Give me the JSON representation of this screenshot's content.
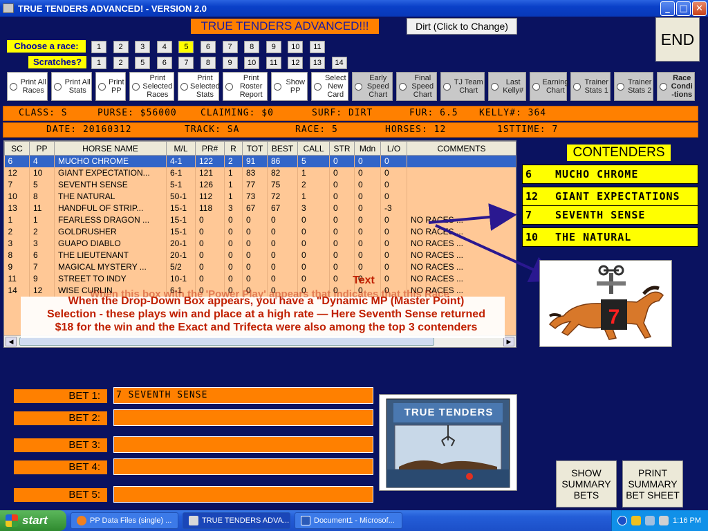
{
  "window": {
    "title": "TRUE TENDERS ADVANCED! - VERSION 2.0"
  },
  "header": {
    "title": "TRUE TENDERS ADVANCED!!!",
    "surface_button": "Dirt (Click to Change)",
    "end_button": "END"
  },
  "race_select": {
    "label": "Choose  a race:",
    "options": [
      "1",
      "2",
      "3",
      "4",
      "5",
      "6",
      "7",
      "8",
      "9",
      "10",
      "11"
    ],
    "selected": "5"
  },
  "scratches": {
    "label": "Scratches?",
    "options": [
      "1",
      "2",
      "5",
      "6",
      "7",
      "8",
      "9",
      "10",
      "11",
      "12",
      "13",
      "14"
    ]
  },
  "options": [
    {
      "label": "Print All Races"
    },
    {
      "label": "Print All Stats"
    },
    {
      "label": "Print PP"
    },
    {
      "label": "Print Selected Races"
    },
    {
      "label": "Print Selected Stats"
    },
    {
      "label": "Print Roster Report"
    },
    {
      "label": "Show PP"
    },
    {
      "label": "Select New Card"
    },
    {
      "label": "Early Speed Chart"
    },
    {
      "label": "Final Speed Chart"
    },
    {
      "label": "TJ Team Chart"
    },
    {
      "label": "Last Kelly#"
    },
    {
      "label": "Earning Chart"
    },
    {
      "label": "Trainer Stats 1"
    },
    {
      "label": "Trainer Stats 2"
    },
    {
      "label": "Race Condi -tions"
    }
  ],
  "race_info": {
    "class": "CLASS: S",
    "purse": "PURSE: $56000",
    "claiming": "CLAIMING: $0",
    "surface": "SURF: DIRT",
    "furlongs": "FUR: 6.5",
    "kelly": "KELLY#: 364",
    "date": "DATE: 20160312",
    "track": "TRACK: SA",
    "race": "RACE: 5",
    "horses": "HORSES: 12",
    "first_time": "1STTIME:  7"
  },
  "grid": {
    "columns": [
      "SC",
      "PP",
      "HORSE NAME",
      "M/L",
      "PR#",
      "R",
      "TOT",
      "BEST",
      "CALL",
      "STR",
      "Mdn",
      "L/O",
      "COMMENTS"
    ],
    "rows": [
      [
        "6",
        "4",
        "MUCHO CHROME",
        "4-1",
        "122",
        "2",
        "91",
        "86",
        "5",
        "0",
        "0",
        "0",
        ""
      ],
      [
        "12",
        "10",
        "GIANT EXPECTATION...",
        "6-1",
        "121",
        "1",
        "83",
        "82",
        "1",
        "0",
        "0",
        "0",
        ""
      ],
      [
        "7",
        "5",
        "SEVENTH SENSE",
        "5-1",
        "126",
        "1",
        "77",
        "75",
        "2",
        "0",
        "0",
        "0",
        ""
      ],
      [
        "10",
        "8",
        "THE NATURAL",
        "50-1",
        "112",
        "1",
        "73",
        "72",
        "1",
        "0",
        "0",
        "0",
        ""
      ],
      [
        "13",
        "11",
        "HANDFUL OF STRIP...",
        "15-1",
        "118",
        "3",
        "67",
        "67",
        "3",
        "0",
        "0",
        "-3",
        ""
      ],
      [
        "1",
        "1",
        "FEARLESS DRAGON ...",
        "15-1",
        "0",
        "0",
        "0",
        "0",
        "0",
        "0",
        "0",
        "0",
        "NO RACES ..."
      ],
      [
        "2",
        "2",
        "GOLDRUSHER",
        "15-1",
        "0",
        "0",
        "0",
        "0",
        "0",
        "0",
        "0",
        "0",
        "NO RACES ..."
      ],
      [
        "3",
        "3",
        "GUAPO DIABLO",
        "20-1",
        "0",
        "0",
        "0",
        "0",
        "0",
        "0",
        "0",
        "0",
        "NO RACES ..."
      ],
      [
        "8",
        "6",
        "THE LIEUTENANT",
        "20-1",
        "0",
        "0",
        "0",
        "0",
        "0",
        "0",
        "0",
        "0",
        "NO RACES ..."
      ],
      [
        "9",
        "7",
        "MAGICAL MYSTERY ...",
        "5/2",
        "0",
        "0",
        "0",
        "0",
        "0",
        "0",
        "0",
        "0",
        "NO RACES ..."
      ],
      [
        "11",
        "9",
        "STREET TO INDY",
        "10-1",
        "0",
        "0",
        "0",
        "0",
        "0",
        "0",
        "0",
        "0",
        "NO RACES ..."
      ],
      [
        "14",
        "12",
        "WISE CURLIN",
        "6-1",
        "0",
        "0",
        "0",
        "0",
        "0",
        "0",
        "0",
        "0",
        "NO RACES ..."
      ]
    ],
    "selected_row": 0
  },
  "annotation": {
    "small_label": "Text",
    "line_0": "When this box with the 'Power Play' appears that indicates that this Race",
    "line_1": "When the Drop-Down Box appears, you have a \"Dynamic MP (Master Point)",
    "line_2": "Selection - these plays win and place at a high rate — Here Seventh Sense returned",
    "line_3": "$18 for the win and the Exact and Trifecta were also among the top 3 contenders"
  },
  "contenders": {
    "title": "CONTENDERS",
    "items": [
      {
        "num": "6",
        "name": "MUCHO CHROME"
      },
      {
        "num": "12",
        "name": "GIANT EXPECTATIONS"
      },
      {
        "num": "7",
        "name": "SEVENTH SENSE"
      },
      {
        "num": "10",
        "name": "THE NATURAL"
      }
    ],
    "horse_badge": "7"
  },
  "bets": [
    {
      "label": "BET 1:",
      "value": "7 SEVENTH SENSE"
    },
    {
      "label": "BET 2:",
      "value": ""
    },
    {
      "label": "BET 3:",
      "value": ""
    },
    {
      "label": "BET 4:",
      "value": ""
    },
    {
      "label": "BET 5:",
      "value": ""
    }
  ],
  "machine_logo": "TRUE TENDERS",
  "buttons": {
    "show_summary": "SHOW SUMMARY BETS",
    "print_summary": "PRINT SUMMARY BET SHEET"
  },
  "taskbar": {
    "start": "start",
    "tasks": [
      "PP Data Files (single) ...",
      "TRUE TENDERS ADVA...",
      "Document1 - Microsof..."
    ],
    "clock": "1:16 PM"
  },
  "colors": {
    "background": "#0a1260",
    "orange": "#ff8000",
    "yellow": "#ffff00",
    "arrow": "#2a1890"
  }
}
